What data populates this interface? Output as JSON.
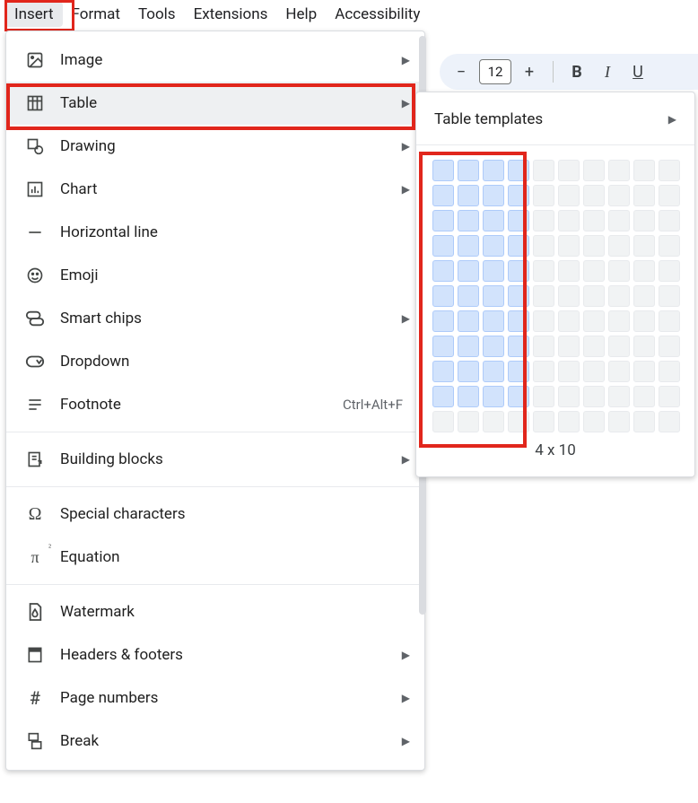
{
  "menubar": {
    "items": [
      {
        "label": "Insert",
        "active": true
      },
      {
        "label": "Format"
      },
      {
        "label": "Tools"
      },
      {
        "label": "Extensions"
      },
      {
        "label": "Help"
      },
      {
        "label": "Accessibility"
      }
    ]
  },
  "toolbar": {
    "font_size": "12",
    "bold": "B",
    "italic": "I",
    "underline": "U"
  },
  "insert_menu": {
    "groups": [
      [
        {
          "icon": "image",
          "label": "Image",
          "submenu": true
        },
        {
          "icon": "table",
          "label": "Table",
          "submenu": true,
          "hover": true
        },
        {
          "icon": "drawing",
          "label": "Drawing",
          "submenu": true
        },
        {
          "icon": "chart",
          "label": "Chart",
          "submenu": true
        },
        {
          "icon": "hline",
          "label": "Horizontal line"
        },
        {
          "icon": "emoji",
          "label": "Emoji"
        },
        {
          "icon": "chips",
          "label": "Smart chips",
          "submenu": true
        },
        {
          "icon": "dropdown",
          "label": "Dropdown"
        },
        {
          "icon": "footnote",
          "label": "Footnote",
          "shortcut": "Ctrl+Alt+F"
        }
      ],
      [
        {
          "icon": "blocks",
          "label": "Building blocks",
          "submenu": true
        }
      ],
      [
        {
          "icon": "omega",
          "label": "Special characters"
        },
        {
          "icon": "equation",
          "label": "Equation"
        }
      ],
      [
        {
          "icon": "watermark",
          "label": "Watermark"
        },
        {
          "icon": "headers",
          "label": "Headers & footers",
          "submenu": true
        },
        {
          "icon": "pagenum",
          "label": "Page numbers",
          "submenu": true
        },
        {
          "icon": "break",
          "label": "Break",
          "submenu": true
        }
      ]
    ]
  },
  "table_submenu": {
    "templates_label": "Table templates",
    "selected_cols": 4,
    "selected_rows": 10,
    "grid_cols": 10,
    "grid_rows": 11,
    "size_label": "4 x 10"
  }
}
